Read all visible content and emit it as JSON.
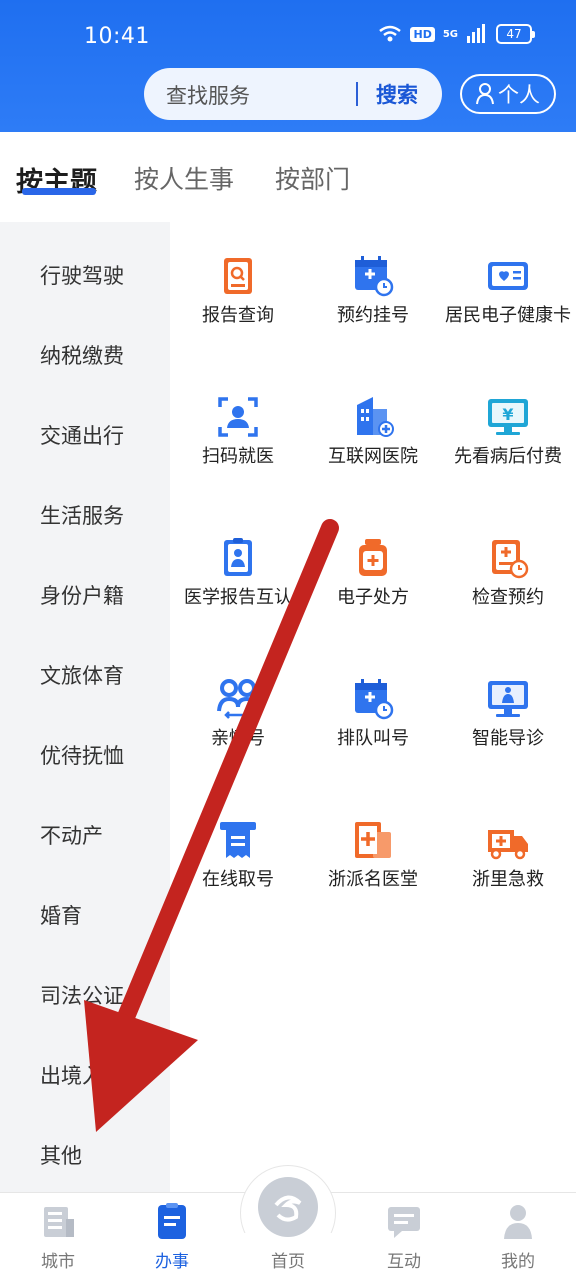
{
  "status": {
    "time": "10:41",
    "hd": "HD",
    "net": "5G",
    "battery": "47"
  },
  "search": {
    "placeholder": "查找服务",
    "button": "搜索"
  },
  "personal": {
    "label": "个人"
  },
  "tabs": [
    {
      "label": "按主题"
    },
    {
      "label": "按人生事"
    },
    {
      "label": "按部门"
    }
  ],
  "sidebar": {
    "items": [
      {
        "label": "行驶驾驶"
      },
      {
        "label": "纳税缴费"
      },
      {
        "label": "交通出行"
      },
      {
        "label": "生活服务"
      },
      {
        "label": "身份户籍"
      },
      {
        "label": "文旅体育"
      },
      {
        "label": "优待抚恤"
      },
      {
        "label": "不动产"
      },
      {
        "label": "婚育"
      },
      {
        "label": "司法公证"
      },
      {
        "label": "出境入"
      },
      {
        "label": "其他"
      }
    ]
  },
  "services": [
    {
      "label": "报告查询",
      "icon": "report-search-icon"
    },
    {
      "label": "预约挂号",
      "icon": "calendar-clock-icon"
    },
    {
      "label": "居民电子健康卡",
      "icon": "health-card-icon"
    },
    {
      "label": "扫码就医",
      "icon": "scan-person-icon"
    },
    {
      "label": "互联网医院",
      "icon": "hospital-building-icon"
    },
    {
      "label": "先看病后付费",
      "icon": "monitor-yen-icon"
    },
    {
      "label": "医学报告互认",
      "icon": "medical-report-icon"
    },
    {
      "label": "电子处方",
      "icon": "medicine-bottle-icon"
    },
    {
      "label": "检查预约",
      "icon": "checkup-clock-icon"
    },
    {
      "label": "亲情号",
      "icon": "family-icon"
    },
    {
      "label": "排队叫号",
      "icon": "queue-calendar-icon"
    },
    {
      "label": "智能导诊",
      "icon": "screen-guide-icon"
    },
    {
      "label": "在线取号",
      "icon": "ticket-icon"
    },
    {
      "label": "浙派名医堂",
      "icon": "medical-folder-icon"
    },
    {
      "label": "浙里急救",
      "icon": "ambulance-icon"
    }
  ],
  "bottom_nav": [
    {
      "label": "城市",
      "icon": "city-icon"
    },
    {
      "label": "办事",
      "icon": "tasks-icon"
    },
    {
      "label": "首页",
      "icon": "home-logo-icon"
    },
    {
      "label": "互动",
      "icon": "chat-icon"
    },
    {
      "label": "我的",
      "icon": "profile-icon"
    }
  ],
  "colors": {
    "primary": "#2a6df0",
    "icon_blue": "#2f74ee",
    "icon_orange": "#f06a2a",
    "arrow_red": "#c4241f"
  }
}
